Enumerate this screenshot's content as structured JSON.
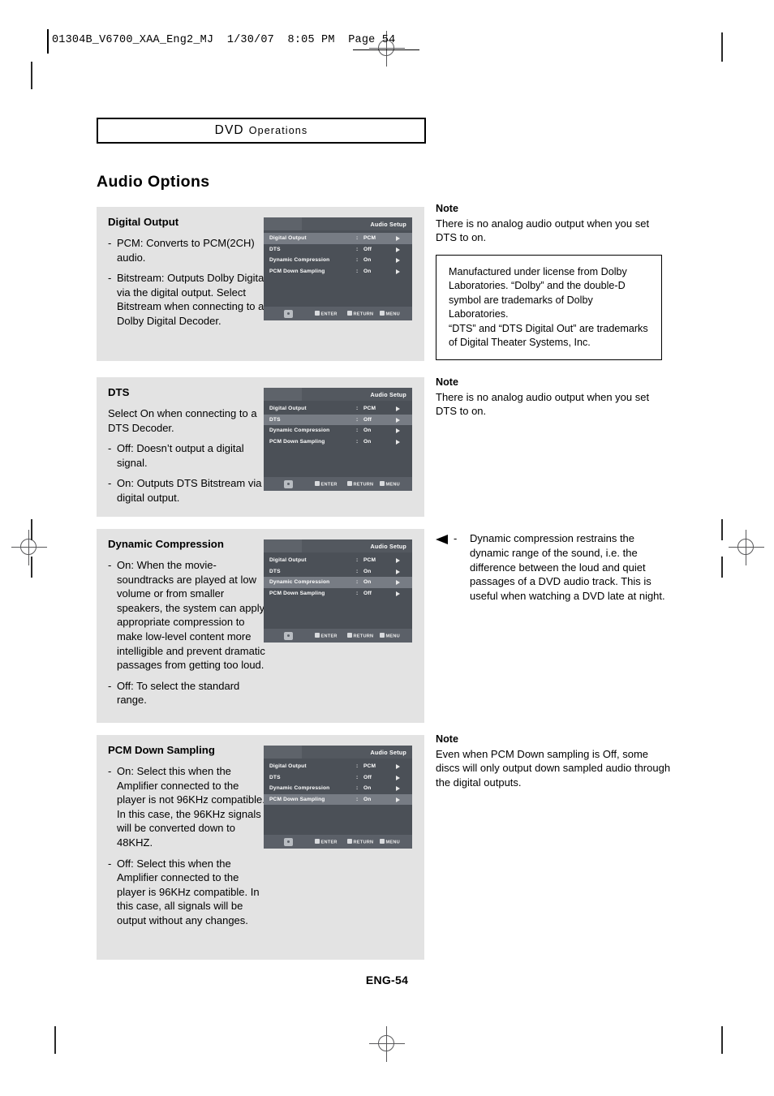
{
  "doc": {
    "header_line": "01304B_V6700_XAA_Eng2_MJ  1/30/07  8:05 PM  Page 54",
    "chapter": "DVD Operations",
    "chapter_main": "DVD",
    "chapter_small": "Operations",
    "page_title": "Audio Options",
    "footer": "ENG-54"
  },
  "sections": [
    {
      "heading": "Digital Output",
      "paragraphs": [
        {
          "dash": true,
          "text": "PCM: Converts to PCM(2CH) audio."
        },
        {
          "dash": true,
          "text": "Bitstream: Outputs Dolby Digital via the digital output. Select Bitstream when connecting to a Dolby Digital Decoder."
        }
      ],
      "osd": {
        "title": "Audio Setup",
        "rows": [
          {
            "label": "Digital Output",
            "value": "PCM",
            "selected": true
          },
          {
            "label": "DTS",
            "value": "Off",
            "selected": false
          },
          {
            "label": "Dynamic Compression",
            "value": "On",
            "selected": false
          },
          {
            "label": "PCM Down Sampling",
            "value": "On",
            "selected": false
          }
        ]
      }
    },
    {
      "heading": "DTS",
      "paragraphs": [
        {
          "dash": false,
          "text": "Select On when connecting to a DTS Decoder."
        },
        {
          "dash": true,
          "text": "Off: Doesn’t output a digital signal."
        },
        {
          "dash": true,
          "text": "On: Outputs DTS Bitstream via digital output."
        }
      ],
      "osd": {
        "title": "Audio Setup",
        "rows": [
          {
            "label": "Digital Output",
            "value": "PCM",
            "selected": false
          },
          {
            "label": "DTS",
            "value": "Off",
            "selected": true
          },
          {
            "label": "Dynamic Compression",
            "value": "On",
            "selected": false
          },
          {
            "label": "PCM Down Sampling",
            "value": "On",
            "selected": false
          }
        ]
      }
    },
    {
      "heading": "Dynamic Compression",
      "paragraphs": [
        {
          "dash": true,
          "text": "On: When the movie-soundtracks are played at low volume or from smaller speakers, the system can apply appropriate compression to make low-level content more intelligible and prevent dramatic passages from getting too loud."
        },
        {
          "dash": true,
          "text": "Off: To select the standard range."
        }
      ],
      "osd": {
        "title": "Audio Setup",
        "rows": [
          {
            "label": "Digital Output",
            "value": "PCM",
            "selected": false
          },
          {
            "label": "DTS",
            "value": "On",
            "selected": false
          },
          {
            "label": "Dynamic Compression",
            "value": "On",
            "selected": true
          },
          {
            "label": "PCM Down Sampling",
            "value": "Off",
            "selected": false
          }
        ]
      }
    },
    {
      "heading": "PCM Down Sampling",
      "paragraphs": [
        {
          "dash": true,
          "text": "On: Select this when the Amplifier connected to the player is not 96KHz compatible. In this case, the 96KHz signals will be converted down to 48KHZ."
        },
        {
          "dash": true,
          "text": "Off: Select this when the Amplifier connected to the player is 96KHz compatible. In this case, all signals will be output without any changes."
        }
      ],
      "osd": {
        "title": "Audio Setup",
        "rows": [
          {
            "label": "Digital Output",
            "value": "PCM",
            "selected": false
          },
          {
            "label": "DTS",
            "value": "Off",
            "selected": false
          },
          {
            "label": "Dynamic Compression",
            "value": "On",
            "selected": false
          },
          {
            "label": "PCM Down Sampling",
            "value": "On",
            "selected": true
          }
        ]
      }
    }
  ],
  "osd_keys": {
    "enter": "ENTER",
    "return": "RETURN",
    "menu": "MENU"
  },
  "right": {
    "note1": {
      "head": "Note",
      "body": "There is no analog audio output when you set DTS to on."
    },
    "trademark": "Manufactured under license from Dolby Laboratories. “Dolby” and the double-D symbol are trademarks of Dolby Laboratories.\n“DTS” and “DTS Digital Out” are trademarks of Digital Theater Systems, Inc.",
    "trademark_line1": "Manufactured under license from Dolby Laboratories. “Dolby” and the double-D symbol are trademarks of Dolby Laboratories.",
    "trademark_line2": "“DTS” and “DTS Digital Out” are trademarks of Digital Theater Systems, Inc.",
    "note2": {
      "head": "Note",
      "body": "There is no analog audio output when you set DTS to on."
    },
    "bullet": {
      "dash": "-",
      "text": "Dynamic compression restrains the dynamic range of the sound, i.e. the difference between the loud and quiet passages of a DVD audio track. This is useful when watching a DVD late at night."
    },
    "note3": {
      "head": "Note",
      "body": "Even when PCM Down sampling is Off, some discs will only output down sampled audio through the digital outputs."
    }
  }
}
